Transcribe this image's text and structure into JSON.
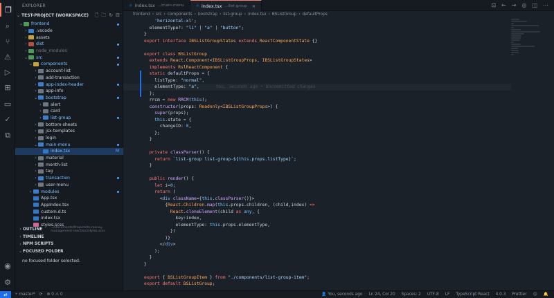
{
  "explorer": {
    "title": "EXPLORER",
    "workspace": "TEST-PROJECT (WORKSPACE)",
    "tree": [
      {
        "label": "frontend",
        "depth": 1,
        "kind": "folder",
        "color": "green",
        "open": true,
        "dot": true
      },
      {
        "label": ".vscode",
        "depth": 2,
        "kind": "folder",
        "color": "blue",
        "open": false
      },
      {
        "label": "assets",
        "depth": 2,
        "kind": "folder",
        "color": "yellow",
        "open": false
      },
      {
        "label": "dist",
        "depth": 2,
        "kind": "folder",
        "color": "red",
        "open": false,
        "dot": true
      },
      {
        "label": "node_modules",
        "depth": 2,
        "kind": "folder",
        "color": "green",
        "open": false,
        "dim": true
      },
      {
        "label": "src",
        "depth": 2,
        "kind": "folder",
        "color": "green",
        "open": true,
        "dot": true
      },
      {
        "label": "components",
        "depth": 3,
        "kind": "folder",
        "color": "yellow",
        "open": true,
        "dot": true
      },
      {
        "label": "account-list",
        "depth": 4,
        "kind": "folder",
        "color": "grey",
        "open": false
      },
      {
        "label": "add-transaction",
        "depth": 4,
        "kind": "folder",
        "color": "grey",
        "open": false
      },
      {
        "label": "app-index-header",
        "depth": 4,
        "kind": "folder",
        "color": "blue",
        "open": false,
        "dot": true
      },
      {
        "label": "app-info",
        "depth": 4,
        "kind": "folder",
        "color": "grey",
        "open": false
      },
      {
        "label": "bootstrap",
        "depth": 4,
        "kind": "folder",
        "color": "blue",
        "open": true,
        "dot": true
      },
      {
        "label": "alert",
        "depth": 5,
        "kind": "folder",
        "color": "grey",
        "open": false
      },
      {
        "label": "card",
        "depth": 5,
        "kind": "folder",
        "color": "grey",
        "open": false
      },
      {
        "label": "list-group",
        "depth": 5,
        "kind": "folder",
        "color": "blue",
        "open": false,
        "dot": true
      },
      {
        "label": "bottom-sheets",
        "depth": 4,
        "kind": "folder",
        "color": "grey",
        "open": false
      },
      {
        "label": "jsx-templates",
        "depth": 4,
        "kind": "folder",
        "color": "grey",
        "open": false
      },
      {
        "label": "login",
        "depth": 4,
        "kind": "folder",
        "color": "grey",
        "open": false
      },
      {
        "label": "main-menu",
        "depth": 4,
        "kind": "folder",
        "color": "blue",
        "open": true,
        "dot": true
      },
      {
        "label": "index.tsx",
        "depth": 5,
        "kind": "tsx",
        "sel": true,
        "mark": "M"
      },
      {
        "label": "material",
        "depth": 4,
        "kind": "folder",
        "color": "grey",
        "open": false
      },
      {
        "label": "month-list",
        "depth": 4,
        "kind": "folder",
        "color": "grey",
        "open": false
      },
      {
        "label": "tag",
        "depth": 4,
        "kind": "folder",
        "color": "grey",
        "open": false
      },
      {
        "label": "transaction",
        "depth": 4,
        "kind": "folder",
        "color": "blue",
        "open": false,
        "dot": true
      },
      {
        "label": "user-menu",
        "depth": 4,
        "kind": "folder",
        "color": "grey",
        "open": false
      },
      {
        "label": "modules",
        "depth": 3,
        "kind": "folder",
        "color": "blue",
        "open": false,
        "dot": true
      },
      {
        "label": "App.tsx",
        "depth": 3,
        "kind": "tsx"
      },
      {
        "label": "AppIndex.tsx",
        "depth": 3,
        "kind": "tsx"
      },
      {
        "label": "custom.d.ts",
        "depth": 3,
        "kind": "ts"
      },
      {
        "label": "index.tsx",
        "depth": 3,
        "kind": "tsx"
      },
      {
        "label": "styles.scss",
        "depth": 3,
        "kind": "scss"
      }
    ],
    "outline_path": "~/Documents/Projects/ts-money-management-react/src/styles.scss",
    "sections": [
      "OUTLINE",
      "TIMELINE",
      "NPM SCRIPTS",
      "FOCUSED FOLDER"
    ],
    "focused_msg": "no focused folder selected."
  },
  "tabs": [
    {
      "label": "index.tsx",
      "desc": ".../main-menu",
      "active": false
    },
    {
      "label": "index.tsx",
      "desc": ".../list-group",
      "active": true
    }
  ],
  "breadcrumbs": [
    "frontend",
    "src",
    "components",
    "bootstrap",
    "list-group",
    "index.tsx",
    "BSListGroup",
    "defaultProps"
  ],
  "code": [
    {
      "n": "",
      "html": "<span class=\"n\">    </span><span class=\"s\">'horizontal-xl'</span><span class=\"n\">;</span>"
    },
    {
      "n": "",
      "html": "<span class=\"n\">  elementType?: </span><span class=\"s\">\"li\"</span><span class=\"n\"> | </span><span class=\"s\">\"a\"</span><span class=\"n\"> | </span><span class=\"s\">\"button\"</span><span class=\"n\">;</span>"
    },
    {
      "n": "",
      "html": "<span class=\"n\">}</span>"
    },
    {
      "n": "",
      "html": "<span class=\"k\">export interface </span><span class=\"t\">IBSListGroupStates </span><span class=\"k\">extends </span><span class=\"t\">ReactComponentState </span><span class=\"n\">{}</span>"
    },
    {
      "n": "",
      "html": ""
    },
    {
      "n": "",
      "html": "<span class=\"k\">export class </span><span class=\"t\">BSListGroup</span>"
    },
    {
      "n": "",
      "html": "<span class=\"n\">  </span><span class=\"k\">extends </span><span class=\"t\">React</span><span class=\"n\">.</span><span class=\"t\">Component</span><span class=\"n\">&lt;</span><span class=\"t\">IBSListGroupProps</span><span class=\"n\">, </span><span class=\"t\">IBSListGroupStates</span><span class=\"n\">&gt;</span>"
    },
    {
      "n": "",
      "html": "<span class=\"n\">  </span><span class=\"k\">implements </span><span class=\"t\">RslReactComponent </span><span class=\"n\">{</span>"
    },
    {
      "n": "",
      "html": "<span class=\"n\">  </span><span class=\"k\">static </span><span class=\"n\">defaultProps = {</span>"
    },
    {
      "n": "",
      "html": "<span class=\"n\">    listType: </span><span class=\"s\">\"normal\"</span><span class=\"n\">,</span>"
    },
    {
      "n": "",
      "html": "<span class=\"n\">    elementType: </span><span class=\"s\">\"a\"</span><span class=\"n\">,</span>",
      "cur": true
    },
    {
      "n": "",
      "html": "<span class=\"n\">  };</span>"
    },
    {
      "n": "",
      "html": "<span class=\"n\">  rrcm = </span><span class=\"k\">new </span><span class=\"f\">RRCM</span><span class=\"n\">(</span><span class=\"p\">this</span><span class=\"n\">);</span>"
    },
    {
      "n": "",
      "html": "<span class=\"n\">  </span><span class=\"f\">constructor</span><span class=\"n\">(props: </span><span class=\"t\">Readonly</span><span class=\"n\">&lt;</span><span class=\"t\">IBSListGroupProps</span><span class=\"n\">&gt;) {</span>"
    },
    {
      "n": "",
      "html": "<span class=\"n\">    </span><span class=\"f\">super</span><span class=\"n\">(props);</span>"
    },
    {
      "n": "",
      "html": "<span class=\"n\">    </span><span class=\"p\">this</span><span class=\"n\">.state = {</span>"
    },
    {
      "n": "",
      "html": "<span class=\"n\">      changeID: </span><span class=\"p\">0</span><span class=\"n\">,</span>"
    },
    {
      "n": "",
      "html": "<span class=\"n\">    };</span>"
    },
    {
      "n": "",
      "html": "<span class=\"n\">  }</span>"
    },
    {
      "n": "",
      "html": ""
    },
    {
      "n": "",
      "html": "<span class=\"n\">  </span><span class=\"k\">private </span><span class=\"f\">classParser</span><span class=\"n\">() {</span>"
    },
    {
      "n": "",
      "html": "<span class=\"n\">    </span><span class=\"k\">return </span><span class=\"s\">`list-group list-group-${</span><span class=\"p\">this</span><span class=\"s\">.props.listType}`</span><span class=\"n\">;</span>"
    },
    {
      "n": "",
      "html": "<span class=\"n\">  }</span>"
    },
    {
      "n": "",
      "html": ""
    },
    {
      "n": "",
      "html": "<span class=\"n\">  </span><span class=\"k\">public </span><span class=\"f\">render</span><span class=\"n\">() {</span>"
    },
    {
      "n": "",
      "html": "<span class=\"n\">    </span><span class=\"k\">let </span><span class=\"n\">i=</span><span class=\"p\">0</span><span class=\"n\">;</span>"
    },
    {
      "n": "",
      "html": "<span class=\"n\">    </span><span class=\"k\">return </span><span class=\"n\">(</span>"
    },
    {
      "n": "",
      "html": "<span class=\"n\">      &lt;</span><span class=\"p\">div </span><span class=\"f\">className</span><span class=\"n\">={</span><span class=\"p\">this</span><span class=\"n\">.</span><span class=\"f\">classParser</span><span class=\"n\">()}&gt;</span>"
    },
    {
      "n": "",
      "html": "<span class=\"n\">        {</span><span class=\"t\">React</span><span class=\"n\">.</span><span class=\"t\">Children</span><span class=\"n\">.</span><span class=\"f\">map</span><span class=\"n\">(</span><span class=\"p\">this</span><span class=\"n\">.props.children, (child,index) </span><span class=\"k\">=&gt;</span>"
    },
    {
      "n": "",
      "html": "<span class=\"n\">          </span><span class=\"t\">React</span><span class=\"n\">.</span><span class=\"f\">cloneElement</span><span class=\"n\">(child </span><span class=\"k\">as </span><span class=\"p\">any</span><span class=\"n\">, {</span>"
    },
    {
      "n": "",
      "html": "<span class=\"n\">            key:index,</span>"
    },
    {
      "n": "",
      "html": "<span class=\"n\">            elementType: </span><span class=\"p\">this</span><span class=\"n\">.props.elementType,</span>"
    },
    {
      "n": "",
      "html": "<span class=\"n\">          })</span>"
    },
    {
      "n": "",
      "html": "<span class=\"n\">        )}</span>"
    },
    {
      "n": "",
      "html": "<span class=\"n\">      &lt;/</span><span class=\"p\">div</span><span class=\"n\">&gt;</span>"
    },
    {
      "n": "",
      "html": "<span class=\"n\">    );</span>"
    },
    {
      "n": "",
      "html": "<span class=\"n\">  }</span>"
    },
    {
      "n": "",
      "html": "<span class=\"n\">}</span>"
    },
    {
      "n": "",
      "html": ""
    },
    {
      "n": "",
      "html": "<span class=\"k\">export </span><span class=\"n\">{ </span><span class=\"t\">BSListGroupItem </span><span class=\"n\">} </span><span class=\"k\">from </span><span class=\"s\">\"./components/list-group-item\"</span><span class=\"n\">;</span>"
    },
    {
      "n": "",
      "html": "<span class=\"k\">export default </span><span class=\"t\">BSListGroup</span><span class=\"n\">;</span>"
    }
  ],
  "blame_ghost": "You, seconds ago • Uncommitted changes",
  "status": {
    "branch": "master*",
    "problems": "0",
    "warnings": "0",
    "blame": "You, seconds ago",
    "position": "Ln 24, Col 20",
    "spaces": "Spaces: 2",
    "encoding": "UTF-8",
    "eol": "LF",
    "language": "TypeScript React",
    "version": "4.0.3",
    "formatter": "Prettier"
  }
}
